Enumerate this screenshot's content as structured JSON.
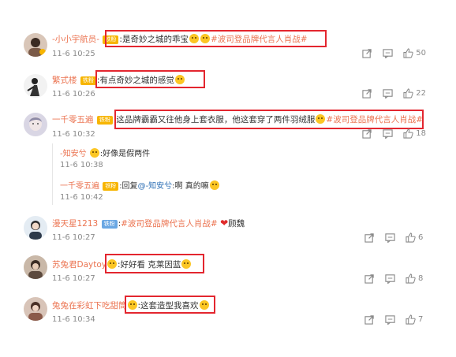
{
  "comments": [
    {
      "user": "-小小宇航员-",
      "badge": "铁粉",
      "text": "是奇妙之城的乖宝",
      "topic": "#波司登品牌代言人肖战#",
      "time": "11-6 10:25",
      "likes": "50"
    },
    {
      "user": "繁式楼",
      "badge": "铁粉",
      "text": "有点奇妙之城的感觉",
      "time": "11-6 10:26",
      "likes": "22"
    },
    {
      "user": "一千零五遍",
      "badge": "铁粉",
      "text": "这品牌霸霸又往他身上套衣服，他这套穿了两件羽绒服",
      "topic": "#波司登品牌代言人肖战#",
      "time": "11-6 10:32",
      "likes": "18",
      "replies": [
        {
          "user": "-知安兮",
          "text": ":好像是假两件",
          "time": "11-6 10:38"
        },
        {
          "user": "一千零五遍",
          "badge": "铁粉",
          "prefix": ":回复",
          "mention": "@-知安兮",
          "text": ":啊 真的嘛",
          "time": "11-6 10:42"
        }
      ]
    },
    {
      "user": "漫天星1213",
      "badge": "铁粉",
      "topic": "#波司登品牌代言人肖战#",
      "text": "顾魏",
      "time": "11-6 10:27",
      "likes": "6"
    },
    {
      "user": "苏兔君Daytoy",
      "text": ":好好看 克莱因蓝",
      "time": "11-6 10:27",
      "likes": "8"
    },
    {
      "user": "兔兔在彩虹下吃甜筒",
      "text": ":这套造型我喜欢",
      "time": "11-6 10:34",
      "likes": "7"
    }
  ],
  "icons": {
    "share": "share-icon",
    "comment": "comment-icon",
    "like": "like-icon"
  },
  "colors": {
    "username": "#eb7350",
    "highlight": "#e3262f",
    "badge": "#f7b500"
  }
}
